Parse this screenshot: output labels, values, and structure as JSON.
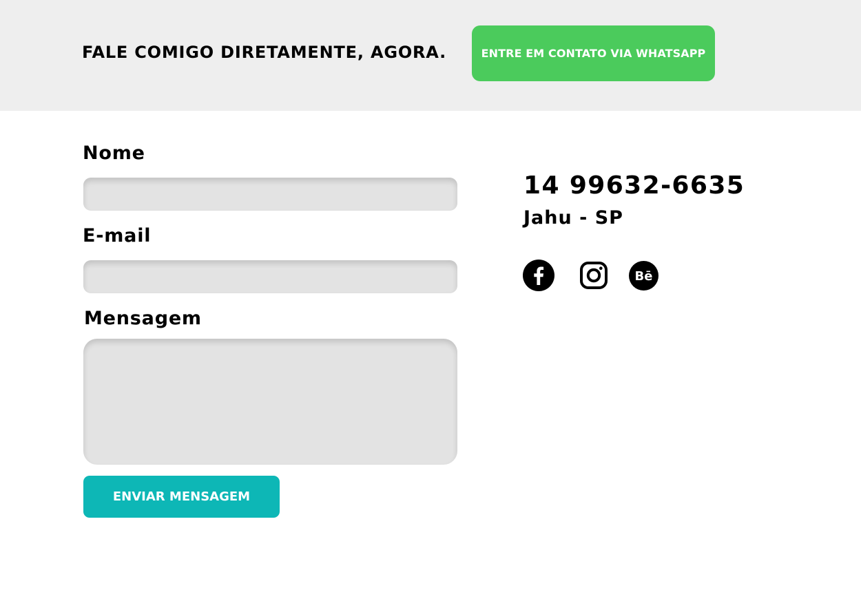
{
  "header": {
    "title": "FALE COMIGO DIRETAMENTE, AGORA.",
    "whatsapp_label": "ENTRE EM CONTATO VIA WHATSAPP",
    "whatsapp_color": "#4bcb5c"
  },
  "form": {
    "name_label": "Nome",
    "name_value": "",
    "email_label": "E-mail",
    "email_value": "",
    "message_label": "Mensagem",
    "message_value": "",
    "submit_label": "ENVIAR MENSAGEM",
    "submit_color": "#0db7b6"
  },
  "contact": {
    "phone": "14 99632-6635",
    "location": "Jahu - SP"
  },
  "social": [
    {
      "icon": "facebook-icon"
    },
    {
      "icon": "instagram-icon"
    },
    {
      "icon": "behance-icon",
      "glyph": "Bē"
    }
  ]
}
